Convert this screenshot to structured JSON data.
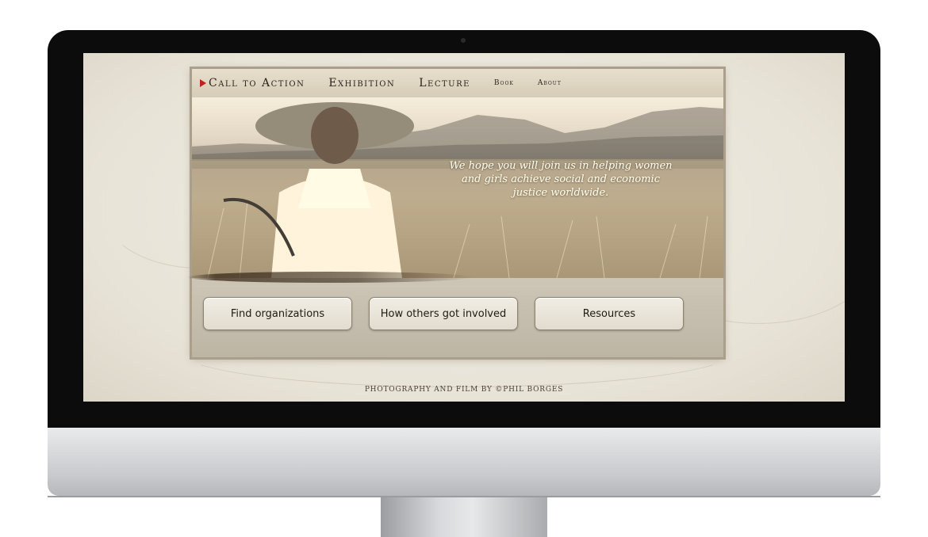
{
  "nav": {
    "items": [
      {
        "label": "Call to Action"
      },
      {
        "label": "Exhibition"
      },
      {
        "label": "Lecture"
      },
      {
        "label": "Book"
      },
      {
        "label": "About"
      }
    ]
  },
  "hero": {
    "quote": "We hope you will join us in helping women and girls achieve social and economic justice worldwide."
  },
  "buttons": [
    {
      "label": "Find organizations"
    },
    {
      "label": "How others got involved"
    },
    {
      "label": "Resources"
    }
  ],
  "footer": {
    "credit": "PHOTOGRAPHY AND FILM BY ©PHIL BORGES"
  },
  "colors": {
    "accent_arrow": "#c0231f",
    "nav_bg": "#e7dfcd",
    "button_bg": "#f1ede4",
    "page_bg": "#e8e3d7"
  },
  "icons": {
    "active_indicator": "red-triangle-icon"
  }
}
